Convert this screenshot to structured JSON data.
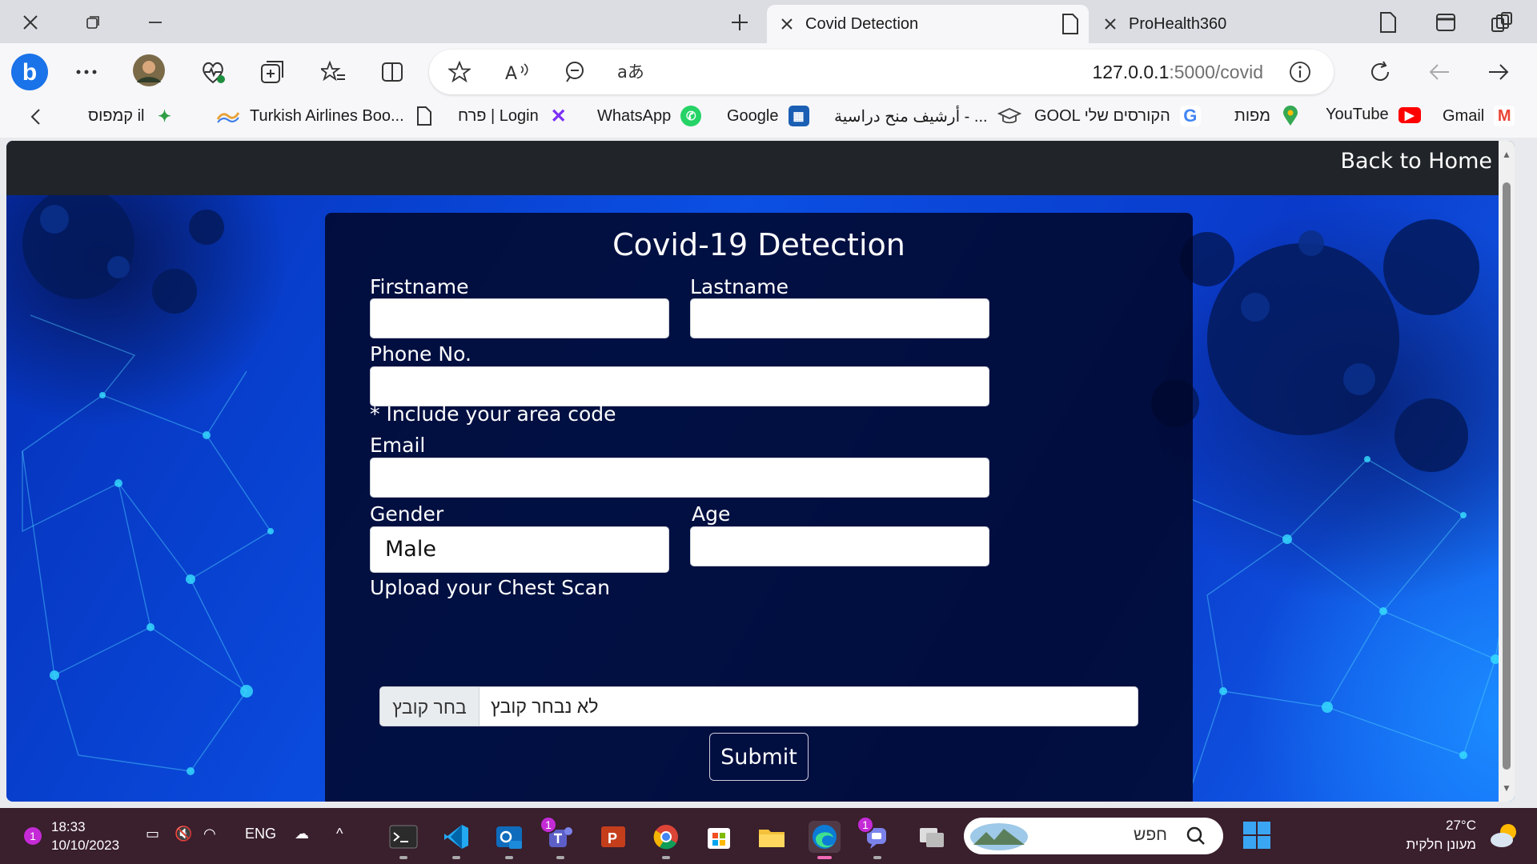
{
  "browser": {
    "tabs": [
      {
        "title": "Covid Detection",
        "active": true
      },
      {
        "title": "ProHealth360",
        "active": false
      }
    ],
    "address": {
      "host": "127.0.0.1",
      "path": ":5000/covid"
    },
    "favorites": [
      {
        "label": "Gmail",
        "icon": "gmail-icon",
        "color": "#ea4335",
        "glyph": "M"
      },
      {
        "label": "YouTube",
        "icon": "youtube-icon",
        "color": "#ff0000",
        "glyph": "▶"
      },
      {
        "label": "מפות",
        "icon": "maps-icon",
        "color": "#34a853",
        "glyph": "⬤"
      },
      {
        "label": "GOOL הקורסים שלי",
        "icon": "gool-icon",
        "color": "#4285f4",
        "glyph": "G"
      },
      {
        "label": "أرشيف منح دراسية - ...",
        "icon": "graduation-cap-icon",
        "color": "#666666",
        "glyph": "🎓"
      },
      {
        "label": "Google",
        "icon": "google-icon",
        "color": "#1a5fb4",
        "glyph": "▦"
      },
      {
        "label": "WhatsApp",
        "icon": "whatsapp-icon",
        "color": "#25d366",
        "glyph": "✆"
      },
      {
        "label": "פרח | Login",
        "icon": "perach-icon",
        "color": "#7b2ff7",
        "glyph": "✕"
      },
      {
        "label": "Turkish Airlines Boo...",
        "icon": "page-icon",
        "color": "#ffffff",
        "glyph": "▯"
      },
      {
        "label": "",
        "icon": "ariel-icon",
        "color": "#e8a33a",
        "glyph": "≋"
      },
      {
        "label": "קמפוס il",
        "icon": "campus-icon",
        "color": "#2f9e44",
        "glyph": "✦"
      }
    ]
  },
  "page": {
    "nav_link": "Back to Home",
    "title": "Covid-19 Detection",
    "fields": {
      "firstname": "Firstname",
      "lastname": "Lastname",
      "phone": "Phone No.",
      "phone_hint": "* Include your area code",
      "email": "Email",
      "gender": "Gender",
      "gender_value": "Male",
      "age": "Age",
      "upload": "Upload your Chest Scan",
      "choose_file": "בחר קובץ",
      "no_file": "לא נבחר קובץ"
    },
    "submit": "Submit"
  },
  "taskbar": {
    "time": "18:33",
    "date": "10/10/2023",
    "language": "ENG",
    "notifications": "1",
    "search_placeholder": "חפש",
    "temperature": "27°C",
    "weather_text": "מעונן חלקית",
    "badge_count": "1"
  },
  "colors": {
    "navbar": "#212529",
    "panel": "#00062a",
    "taskbar": "#3a1f2d",
    "edge_blue": "#1a73e8"
  }
}
